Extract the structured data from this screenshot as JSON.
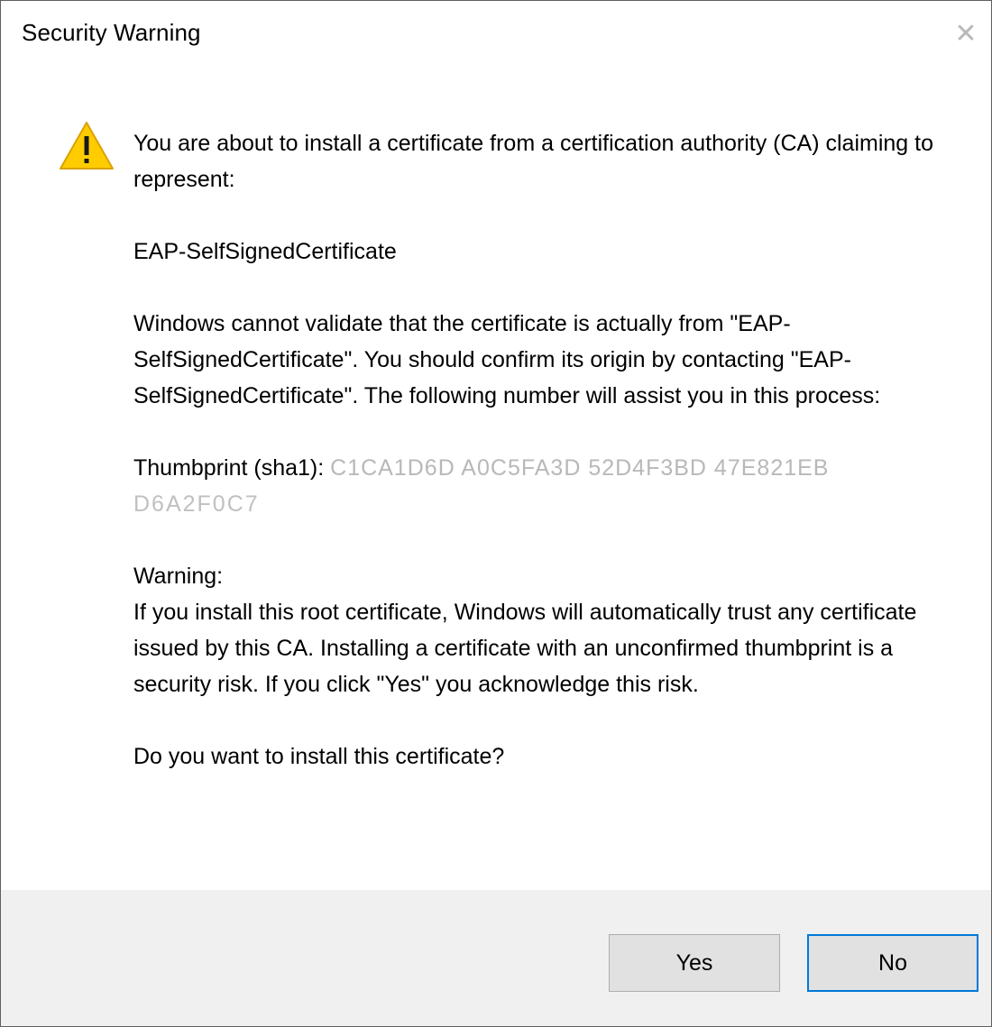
{
  "window": {
    "title": "Security Warning",
    "close_glyph": "✕"
  },
  "icons": {
    "warning": "warning-icon",
    "close": "close-icon"
  },
  "message": {
    "intro": "You are about to install a certificate from a certification authority (CA) claiming to represent:",
    "ca_name": "EAP-SelfSignedCertificate",
    "validation_text": "Windows cannot validate that the certificate is actually from \"EAP-SelfSignedCertificate\". You should confirm its origin by contacting \"EAP-SelfSignedCertificate\". The following number will assist you in this process:",
    "thumbprint_label": "Thumbprint (sha1): ",
    "thumbprint_line1": "C1CA1D6D A0C5FA3D 52D4F3BD 47E821EB",
    "thumbprint_line2": "D6A2F0C7",
    "warning_heading": "Warning:",
    "warning_text": "If you install this root certificate, Windows will automatically trust any certificate issued by this CA. Installing a certificate with an unconfirmed thumbprint is a security risk. If you click \"Yes\" you acknowledge this risk.",
    "question": "Do you want to install this certificate?"
  },
  "buttons": {
    "yes": "Yes",
    "no": "No"
  },
  "colors": {
    "accent_focus": "#0078d7",
    "footer_bg": "#f0f0f0",
    "button_bg": "#e1e1e1",
    "warning_yellow": "#ffcc00"
  }
}
